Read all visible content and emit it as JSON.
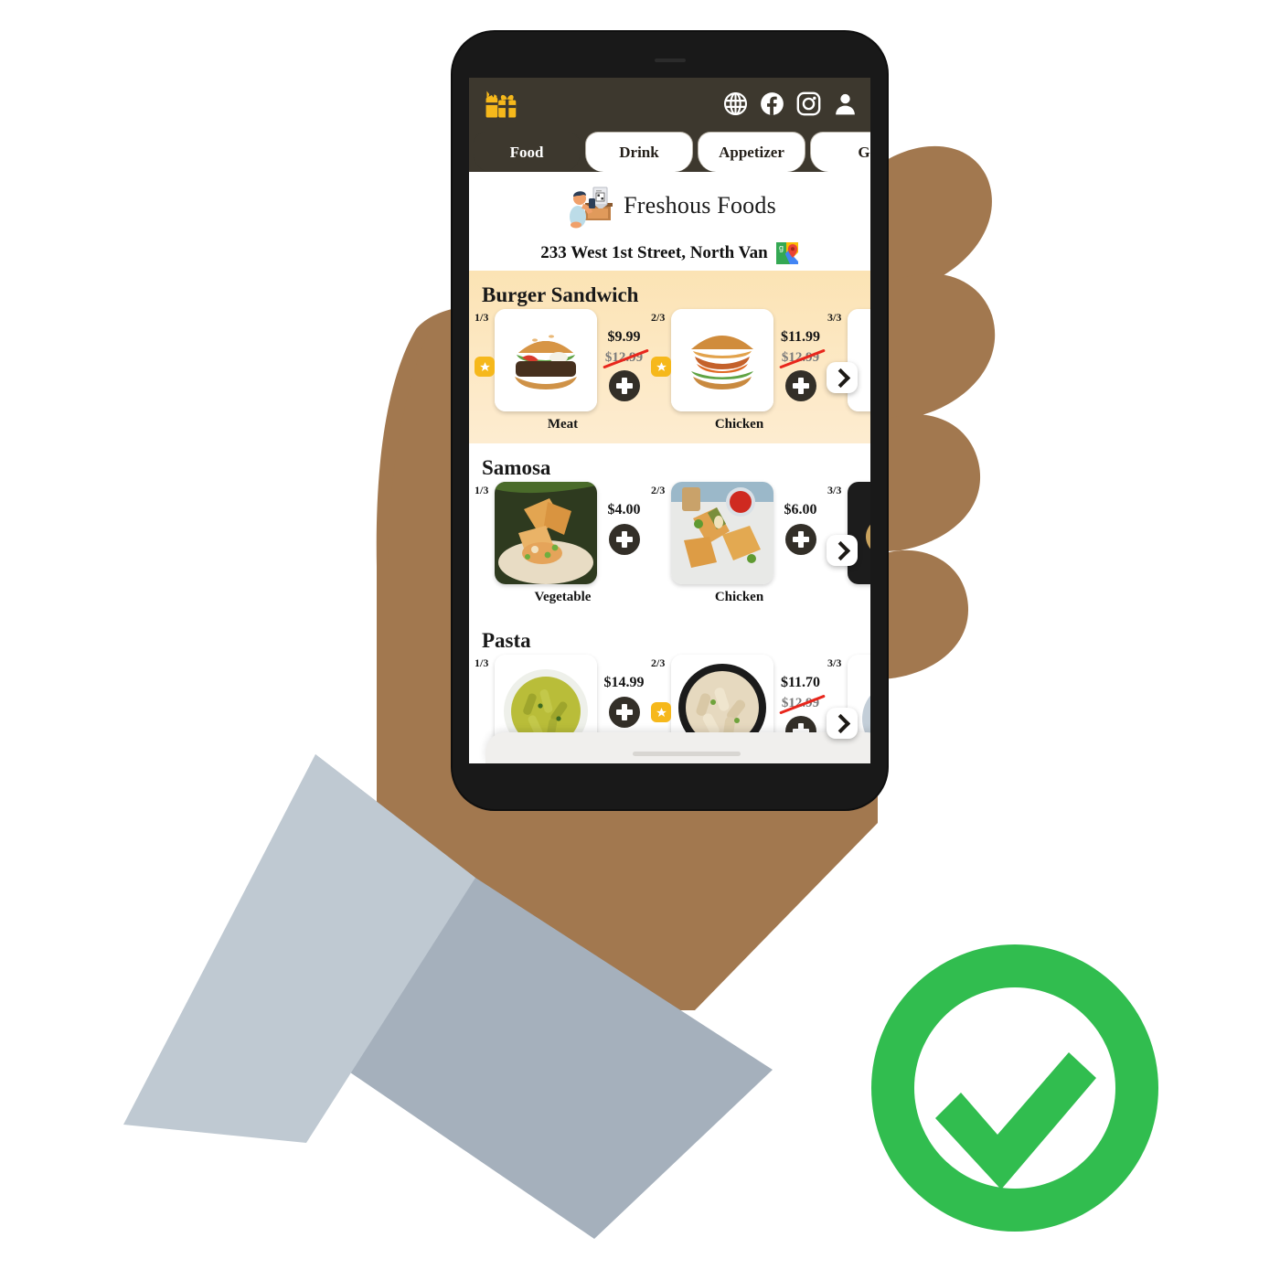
{
  "app": {
    "brand_icon": "gift-icon",
    "header_bg": "#3d382e",
    "accent": "#f6b81b",
    "social_icons": [
      "globe-icon",
      "facebook-icon",
      "instagram-icon",
      "profile-icon"
    ]
  },
  "tabs": [
    {
      "label": "Food",
      "active": true
    },
    {
      "label": "Drink",
      "active": false
    },
    {
      "label": "Appetizer",
      "active": false
    },
    {
      "label": "G",
      "active": false
    }
  ],
  "restaurant": {
    "name": "Freshous Foods",
    "logo_icon": "qr-scan-illustration",
    "address": "233 West 1st Street, North Van",
    "map_icon": "google-maps-icon"
  },
  "sections": [
    {
      "title": "Burger Sandwich",
      "highlight": true,
      "next_label": "next-arrow",
      "items": [
        {
          "index": "1/3",
          "name": "Meat",
          "price": "$9.99",
          "old_price": "$12.99",
          "featured": true,
          "image": "burger-meat"
        },
        {
          "index": "2/3",
          "name": "Chicken",
          "price": "$11.99",
          "old_price": "$12.99",
          "featured": true,
          "image": "burger-chicken"
        },
        {
          "index": "3/3",
          "name": "",
          "price": "",
          "old_price": "",
          "featured": false,
          "image": "burger-third"
        }
      ]
    },
    {
      "title": "Samosa",
      "highlight": false,
      "next_label": "next-arrow",
      "items": [
        {
          "index": "1/3",
          "name": "Vegetable",
          "price": "$4.00",
          "old_price": "",
          "featured": false,
          "image": "samosa-vegetable"
        },
        {
          "index": "2/3",
          "name": "Chicken",
          "price": "$6.00",
          "old_price": "",
          "featured": false,
          "image": "samosa-chicken"
        },
        {
          "index": "3/3",
          "name": "",
          "price": "",
          "old_price": "",
          "featured": false,
          "image": "samosa-third"
        }
      ]
    },
    {
      "title": "Pasta",
      "highlight": false,
      "next_label": "next-arrow",
      "items": [
        {
          "index": "1/3",
          "name": "",
          "price": "$14.99",
          "old_price": "",
          "featured": false,
          "image": "pasta-pesto"
        },
        {
          "index": "2/3",
          "name": "",
          "price": "$11.70",
          "old_price": "$12.99",
          "featured": true,
          "image": "pasta-chicken-alfredo"
        },
        {
          "index": "3/3",
          "name": "",
          "price": "",
          "old_price": "",
          "featured": false,
          "image": "pasta-third"
        }
      ]
    }
  ],
  "status": {
    "icon": "green-check-circle-icon",
    "color": "#31bd4f"
  },
  "scene": {
    "hand_color": "#a2784f",
    "sleeve_light": "#bfc9d2",
    "sleeve_dark": "#a5b0bc"
  }
}
